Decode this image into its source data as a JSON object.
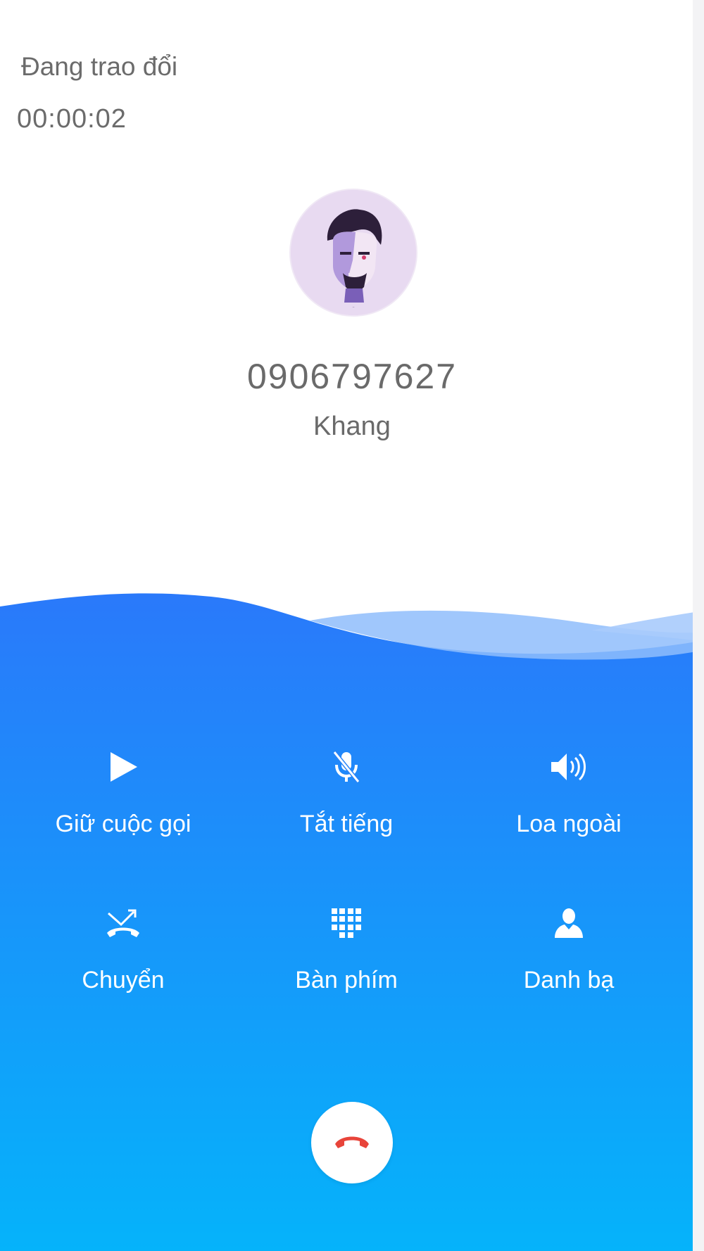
{
  "call": {
    "status": "Đang trao đổi",
    "timer": "00:00:02",
    "phone_number": "0906797627",
    "contact_name": "Khang"
  },
  "controls": [
    {
      "label": "Giữ cuộc gọi",
      "icon": "play-icon"
    },
    {
      "label": "Tắt tiếng",
      "icon": "mic-off-icon"
    },
    {
      "label": "Loa ngoài",
      "icon": "speaker-icon"
    },
    {
      "label": "Chuyển",
      "icon": "call-transfer-icon"
    },
    {
      "label": "Bàn phím",
      "icon": "keypad-icon"
    },
    {
      "label": "Danh bạ",
      "icon": "contact-icon"
    }
  ],
  "end_call": {
    "icon": "hangup-icon"
  },
  "colors": {
    "gradient_top": "#2a7ff8",
    "gradient_bottom": "#05b3fa",
    "hangup_red": "#e8443a",
    "text_gray": "#6b6b6b"
  }
}
